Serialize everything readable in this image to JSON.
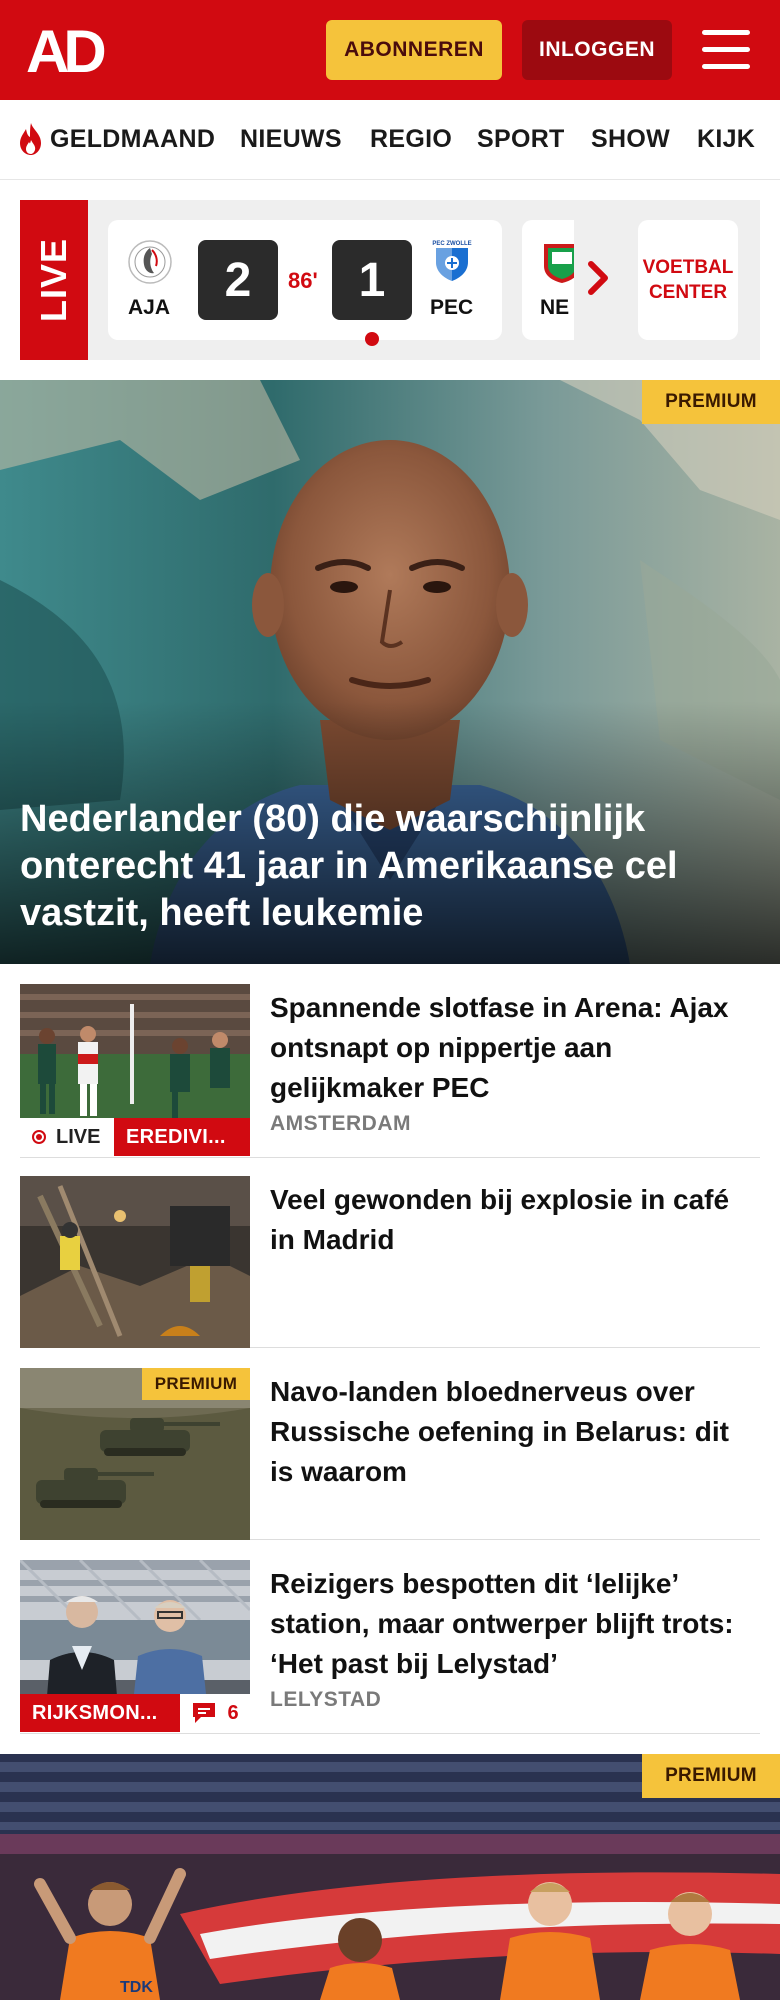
{
  "header": {
    "logo_text": "AD",
    "subscribe_label": "ABONNEREN",
    "login_label": "INLOGGEN",
    "menu_icon": "hamburger-menu-icon",
    "brand_color": "#d10a11",
    "subscribe_color": "#f5c33b"
  },
  "nav": {
    "items": [
      "GELDMAAND",
      "NIEUWS",
      "REGIO",
      "SPORT",
      "SHOW",
      "KIJK"
    ],
    "first_item_icon": "flame-icon"
  },
  "live_scores": {
    "tab_label": "LIVE",
    "match": {
      "home_team": "AJA",
      "home_score": "2",
      "minute": "86'",
      "away_score": "1",
      "away_team": "PEC",
      "away_logo_text": "PEC ZWOLLE"
    },
    "next_match_team": "NE",
    "next_icon": "chevron-right-icon",
    "center_label_line1": "VOETBAL",
    "center_label_line2": "CENTER"
  },
  "hero": {
    "badge": "PREMIUM",
    "title": "Nederlander (80) die waarschijnlijk onterecht 41 jaar in Amerikaanse cel vastzit, heeft leukemie"
  },
  "articles": [
    {
      "title": "Spannende slotfase in Arena: Ajax ontsnapt op nippertje aan gelijkmaker PEC",
      "location": "AMSTERDAM",
      "live_label": "LIVE",
      "category": "EREDIVI..."
    },
    {
      "title": "Veel gewonden bij explosie in café in Madrid"
    },
    {
      "title": "Navo-landen bloednerveus over Russische oefening in Belarus: dit is waarom",
      "badge": "PREMIUM"
    },
    {
      "title": "Reizigers bespotten dit ‘lelijke’ station, maar ontwerper blijft trots: ‘Het past bij Lelystad’",
      "location": "LELYSTAD",
      "category": "RIJKSMON...",
      "comments": "6"
    }
  ],
  "hero2": {
    "badge": "PREMIUM",
    "banner_text": "TDK"
  }
}
